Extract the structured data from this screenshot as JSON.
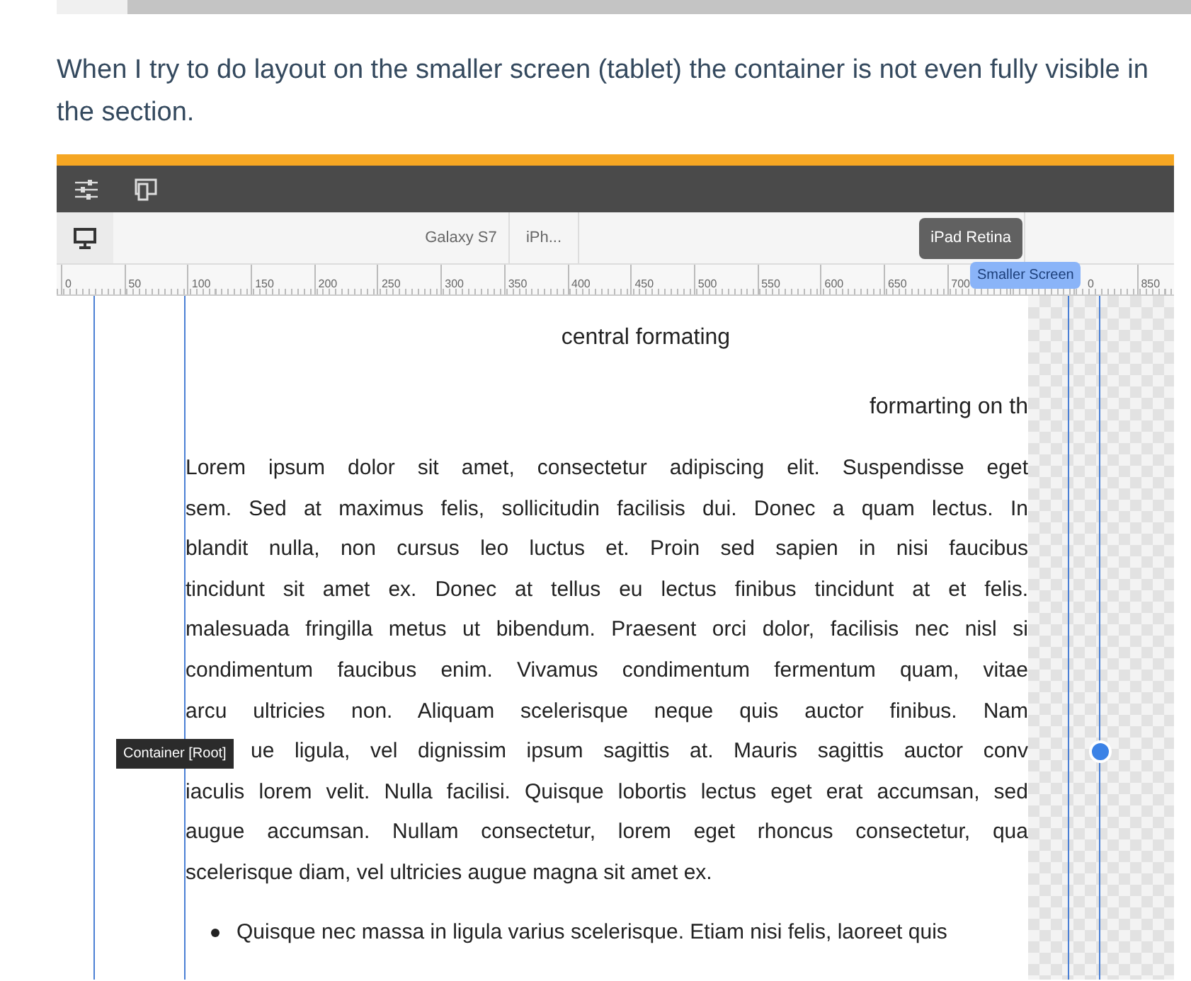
{
  "question": "When I try to do layout on the smaller screen (tablet) the container is not even fully visible in the section.",
  "editor": {
    "devices": [
      {
        "label": "Galaxy S7",
        "selected": false
      },
      {
        "label": "iPh...",
        "selected": false
      },
      {
        "label": "iPad Retina",
        "selected": true
      }
    ],
    "breakpoint_label": "Smaller Screen",
    "ruler": [
      {
        "label": "0",
        "kind": "full"
      },
      {
        "label": "50",
        "kind": "full"
      },
      {
        "label": "100",
        "kind": "full"
      },
      {
        "label": "150",
        "kind": "full"
      },
      {
        "label": "200",
        "kind": "full"
      },
      {
        "label": "250",
        "kind": "full"
      },
      {
        "label": "300",
        "kind": "full"
      },
      {
        "label": "350",
        "kind": "full"
      },
      {
        "label": "400",
        "kind": "full"
      },
      {
        "label": "450",
        "kind": "full"
      },
      {
        "label": "500",
        "kind": "full"
      },
      {
        "label": "550",
        "kind": "full"
      },
      {
        "label": "600",
        "kind": "full"
      },
      {
        "label": "650",
        "kind": "full"
      },
      {
        "label": "700",
        "kind": "full"
      },
      {
        "kind": "hidden"
      },
      {
        "label": "0",
        "kind": "partial"
      },
      {
        "label": "850",
        "kind": "full"
      }
    ],
    "canvas": {
      "heading": "central formating",
      "right_text": "formarting on th",
      "paragraph_lines": [
        "Lorem ipsum dolor sit amet, consectetur adipiscing elit. Suspendisse eget",
        "sem. Sed at maximus felis, sollicitudin facilisis dui. Donec a quam lectus. In",
        "blandit nulla, non cursus leo luctus et. Proin sed sapien in nisi faucibus",
        "tincidunt sit amet ex. Donec at tellus eu lectus finibus tincidunt at et felis.",
        "malesuada fringilla metus ut bibendum. Praesent orci dolor, facilisis nec nisl si",
        "condimentum faucibus enim. Vivamus condimentum fermentum quam, vitae",
        "arcu ultricies non. Aliquam scelerisque neque quis auctor finibus. Nam",
        "ue ligula, vel dignissim ipsum sagittis at. Mauris sagittis auctor conv",
        "iaculis lorem velit. Nulla facilisi. Quisque lobortis lectus eget erat accumsan, sed",
        "augue accumsan. Nullam consectetur, lorem eget rhoncus consectetur, qua",
        "scelerisque diam, vel ultricies augue magna sit amet ex."
      ],
      "bullets": [
        "Quisque nec massa in ligula varius scelerisque. Etiam nisi felis, laoreet quis"
      ],
      "tooltip": "Container [Root]"
    }
  }
}
